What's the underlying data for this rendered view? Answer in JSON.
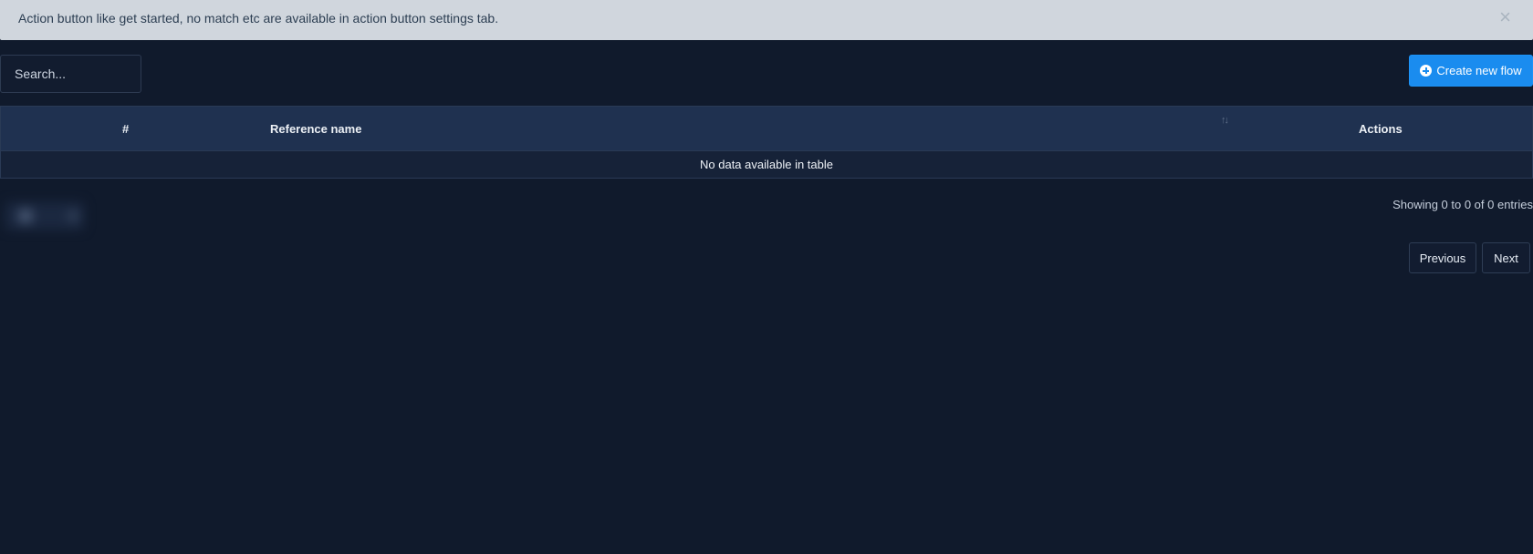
{
  "alert": {
    "message": "Action button like get started, no match etc are available in action button settings tab.",
    "close_glyph": "×"
  },
  "search": {
    "placeholder": "Search...",
    "value": ""
  },
  "toolbar": {
    "create_label": "Create new flow",
    "create_icon": "plus-circle-icon"
  },
  "table": {
    "columns": [
      "#",
      "Reference name",
      "Actions"
    ],
    "sort_glyph": "↑↓",
    "empty_message": "No data available in table"
  },
  "info": {
    "text": "Showing 0 to 0 of 0 entries"
  },
  "pagination": {
    "previous_label": "Previous",
    "next_label": "Next"
  },
  "colors": {
    "background": "#101a2c",
    "alert_bg": "#d0d6dd",
    "accent": "#1a8cef",
    "table_header": "#1f3150"
  }
}
